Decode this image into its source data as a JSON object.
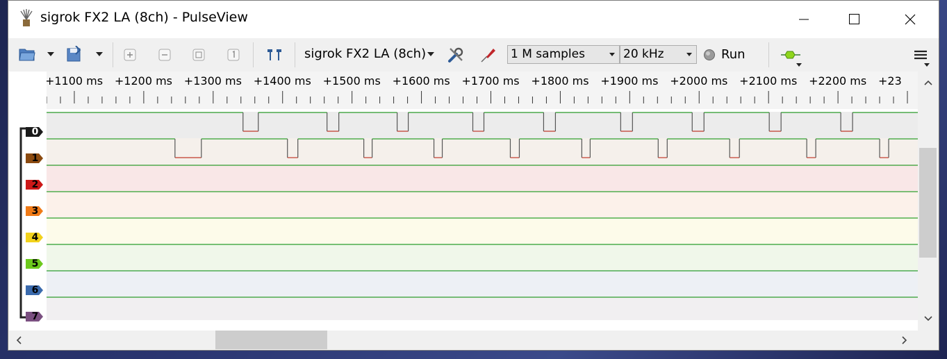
{
  "window": {
    "title": "sigrok FX2 LA (8ch) - PulseView",
    "controls": [
      "minimize-icon",
      "maximize-icon",
      "close-icon"
    ]
  },
  "toolbar": {
    "device": "sigrok FX2 LA (8ch)",
    "sample_count": "1 M samples",
    "sample_rate": "20 kHz",
    "run_label": "Run",
    "icons": [
      "open-file-icon",
      "save-icon",
      "zoom-in-icon",
      "zoom-out-icon",
      "zoom-fit-icon",
      "zoom-one-to-one-icon",
      "cursor-icon",
      "device-config-icon",
      "probe-icon",
      "decoder-icon",
      "menu-icon"
    ]
  },
  "ruler": {
    "ticks": [
      "+1100 ms",
      "+1200 ms",
      "+1300 ms",
      "+1400 ms",
      "+1500 ms",
      "+1600 ms",
      "+1700 ms",
      "+1800 ms",
      "+1900 ms",
      "+2000 ms",
      "+2100 ms",
      "+2200 ms",
      "+23"
    ]
  },
  "channels": [
    {
      "label": "0",
      "color": "#1a1a1a",
      "lane_bg": "#ececec"
    },
    {
      "label": "1",
      "color": "#8b4a10",
      "lane_bg": "#f5f0eb"
    },
    {
      "label": "2",
      "color": "#cc1818",
      "lane_bg": "#f9e7e7"
    },
    {
      "label": "3",
      "color": "#f07a16",
      "lane_bg": "#fcf1ea"
    },
    {
      "label": "4",
      "color": "#f2d21c",
      "lane_bg": "#fdfbea"
    },
    {
      "label": "5",
      "color": "#6cc91c",
      "lane_bg": "#f0f7ea"
    },
    {
      "label": "6",
      "color": "#3a6aad",
      "lane_bg": "#edf0f5"
    },
    {
      "label": "7",
      "color": "#7a4f80",
      "lane_bg": "#f1eff1"
    }
  ],
  "signals": {
    "time_start_ms": 1060,
    "time_end_ms": 2315,
    "ch0_low_pulses_ms": [
      [
        1343,
        1365
      ],
      [
        1464,
        1481
      ],
      [
        1565,
        1581
      ],
      [
        1674,
        1690
      ],
      [
        1776,
        1793
      ],
      [
        1887,
        1904
      ],
      [
        1990,
        2007
      ],
      [
        2101,
        2118
      ],
      [
        2204,
        2221
      ]
    ],
    "ch1_low_pulses_ms": [
      [
        1245,
        1283
      ],
      [
        1407,
        1422
      ],
      [
        1517,
        1529
      ],
      [
        1618,
        1630
      ],
      [
        1728,
        1741
      ],
      [
        1831,
        1843
      ],
      [
        1941,
        1954
      ],
      [
        2044,
        2058
      ],
      [
        2155,
        2168
      ],
      [
        2260,
        2273
      ]
    ],
    "high_color": "#2e9e2e",
    "low_color": "#c0392b"
  }
}
